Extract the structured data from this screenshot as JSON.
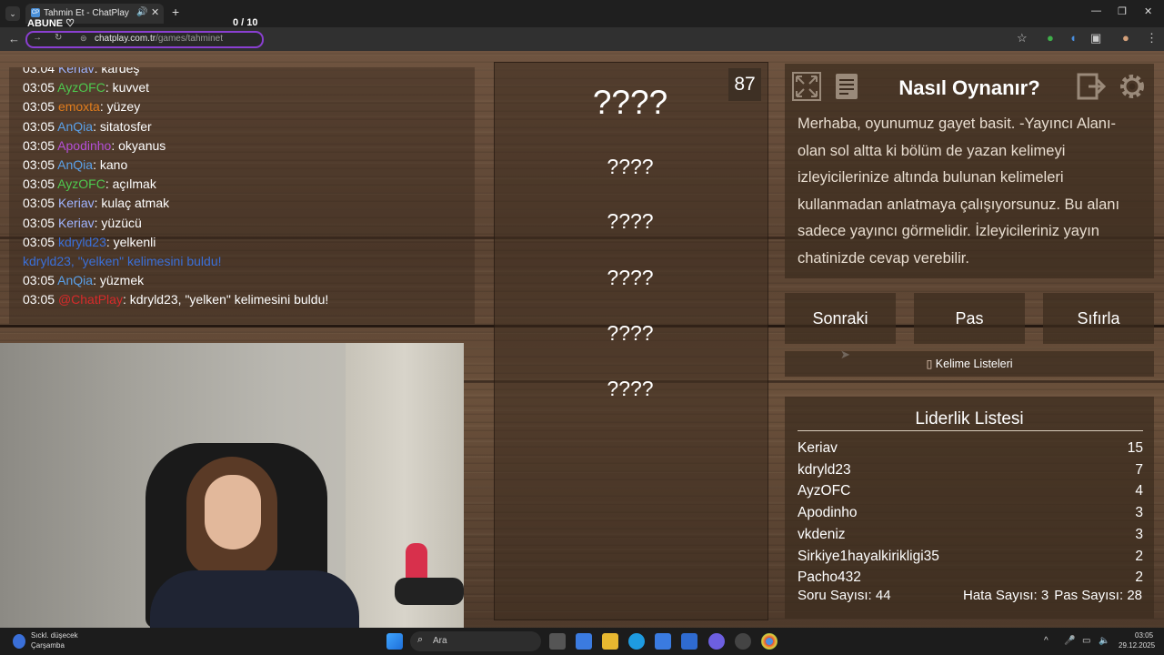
{
  "browser": {
    "tab_title": "Tahmin Et - ChatPlay",
    "tab_favicon": "CP",
    "url_host": "chatplay.com.tr",
    "url_path": "/games/tahminet",
    "overlay_abune": "ABUNE ♡",
    "overlay_score": "0  / 10"
  },
  "chat": {
    "messages": [
      {
        "time": "03:04",
        "user": "Keriav",
        "color": "#9fb4ff",
        "text": ": kardeş"
      },
      {
        "time": "03:05",
        "user": "AyzOFC",
        "color": "#4ec94e",
        "text": ": kuvvet"
      },
      {
        "time": "03:05",
        "user": "emoxta",
        "color": "#e07c1c",
        "text": ": yüzey"
      },
      {
        "time": "03:05",
        "user": "AnQia",
        "color": "#5aa0e8",
        "text": ": sitatosfer"
      },
      {
        "time": "03:05",
        "user": "Apodinho",
        "color": "#b44fd6",
        "text": ": okyanus"
      },
      {
        "time": "03:05",
        "user": "AnQia",
        "color": "#5aa0e8",
        "text": ": kano"
      },
      {
        "time": "03:05",
        "user": "AyzOFC",
        "color": "#4ec94e",
        "text": ": açılmak"
      },
      {
        "time": "03:05",
        "user": "Keriav",
        "color": "#9fb4ff",
        "text": ": kulaç atmak"
      },
      {
        "time": "03:05",
        "user": "Keriav",
        "color": "#9fb4ff",
        "text": ": yüzücü"
      },
      {
        "time": "03:05",
        "user": "kdryld23",
        "color": "#3a6fd8",
        "text": ": yelkenli"
      },
      {
        "time": "",
        "user": "",
        "color": "#3a6fd8",
        "text": "kdryld23, \"yelken\" kelimesini buldu!"
      },
      {
        "time": "03:05",
        "user": "AnQia",
        "color": "#5aa0e8",
        "text": ": yüzmek"
      },
      {
        "time": "03:05",
        "user": "@ChatPlay",
        "color": "#d62a2a",
        "text": ": kdryld23, \"yelken\" kelimesini buldu!"
      }
    ]
  },
  "game": {
    "timer": "87",
    "words": [
      "????",
      "????",
      "????",
      "????",
      "????",
      "????"
    ]
  },
  "howto": {
    "title": "Nasıl Oynanır?",
    "body": "Merhaba, oyunumuz gayet basit. -Yayıncı Alanı- olan sol altta ki bölüm de yazan kelimeyi izleyicilerinize altında bulunan kelimeleri kullanmadan anlatmaya çalışıyorsunuz. Bu alanı sadece yayıncı görmelidir. İzleyicileriniz yayın chatinizde cevap verebilir."
  },
  "buttons": {
    "next": "Sonraki",
    "pass": "Pas",
    "reset": "Sıfırla",
    "word_lists": "Kelime Listeleri"
  },
  "leaderboard": {
    "title": "Liderlik Listesi",
    "rows": [
      {
        "name": "Keriav",
        "score": "15"
      },
      {
        "name": "kdryld23",
        "score": "7"
      },
      {
        "name": "AyzOFC",
        "score": "4"
      },
      {
        "name": "Apodinho",
        "score": "3"
      },
      {
        "name": "vkdeniz",
        "score": "3"
      },
      {
        "name": "Sirkiye1hayalkirikligi35",
        "score": "2"
      },
      {
        "name": "Pacho432",
        "score": "2"
      }
    ]
  },
  "stats": {
    "questions": "Soru Sayısı: 44",
    "errors": "Hata Sayısı: 3",
    "passes": "Pas Sayısı: 28"
  },
  "taskbar": {
    "weather_title": "Sıckl. düşecek",
    "weather_day": "Çarşamba",
    "search": "Ara",
    "time": "03:05",
    "date": "29.12.2025"
  }
}
